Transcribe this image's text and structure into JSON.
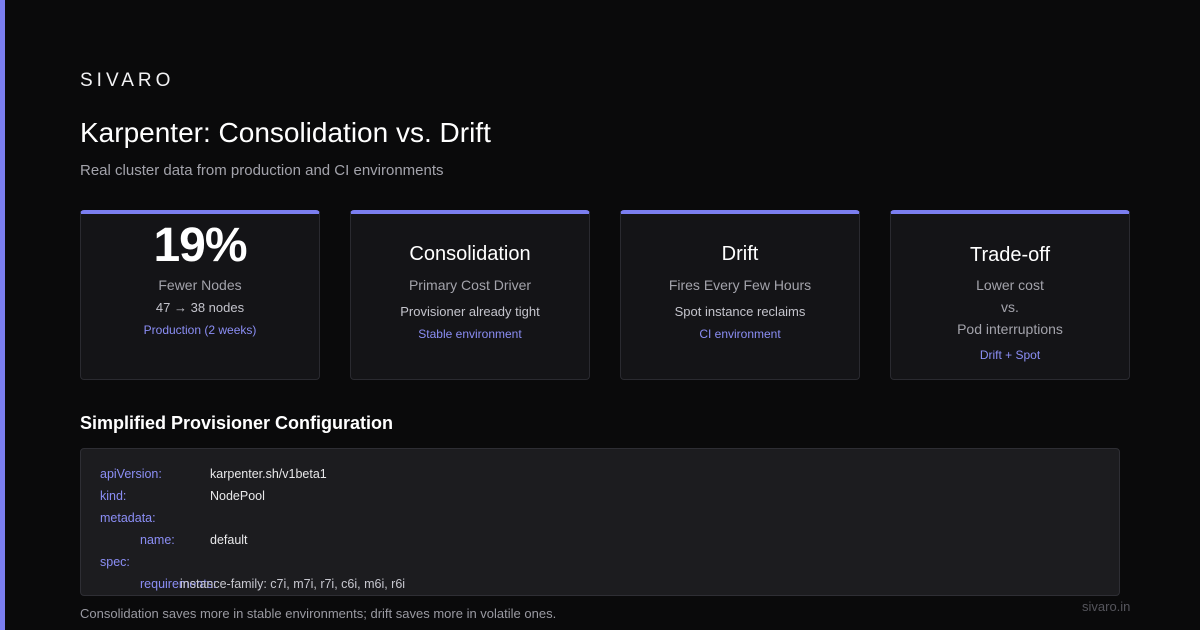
{
  "brand": "SIVARO",
  "title": "Karpenter: Consolidation vs. Drift",
  "subtitle": "Real cluster data from production and CI environments",
  "cards": [
    {
      "big": "19%",
      "label": "Fewer Nodes",
      "detail": "47 → 38 nodes",
      "note": "Production (2 weeks)"
    },
    {
      "head": "Consolidation",
      "label": "Primary Cost Driver",
      "detail": "Provisioner already tight",
      "note": "Stable environment"
    },
    {
      "head": "Drift",
      "label": "Fires Every Few Hours",
      "detail": "Spot instance reclaims",
      "note": "CI environment"
    },
    {
      "head": "Trade-off",
      "lines": [
        "Lower cost",
        "vs.",
        "Pod interruptions"
      ],
      "note": "Drift + Spot"
    }
  ],
  "section_title": "Simplified Provisioner Configuration",
  "code": [
    {
      "key": "apiVersion:",
      "value": "karpenter.sh/v1beta1"
    },
    {
      "key": "kind:",
      "value": "NodePool"
    },
    {
      "key": "metadata:",
      "value": ""
    },
    {
      "key": "name:",
      "value": "default"
    },
    {
      "key": "spec:",
      "value": ""
    },
    {
      "key": "requirements:",
      "value": "instance-family: c7i, m7i, r7i, c6i, m6i, r6i"
    }
  ],
  "footer": "Consolidation saves more in stable environments; drift saves more in volatile ones.",
  "site": "sivaro.in",
  "colors": {
    "accent": "#7b7ef0",
    "background": "#0a0a0b",
    "card": "#141417"
  }
}
